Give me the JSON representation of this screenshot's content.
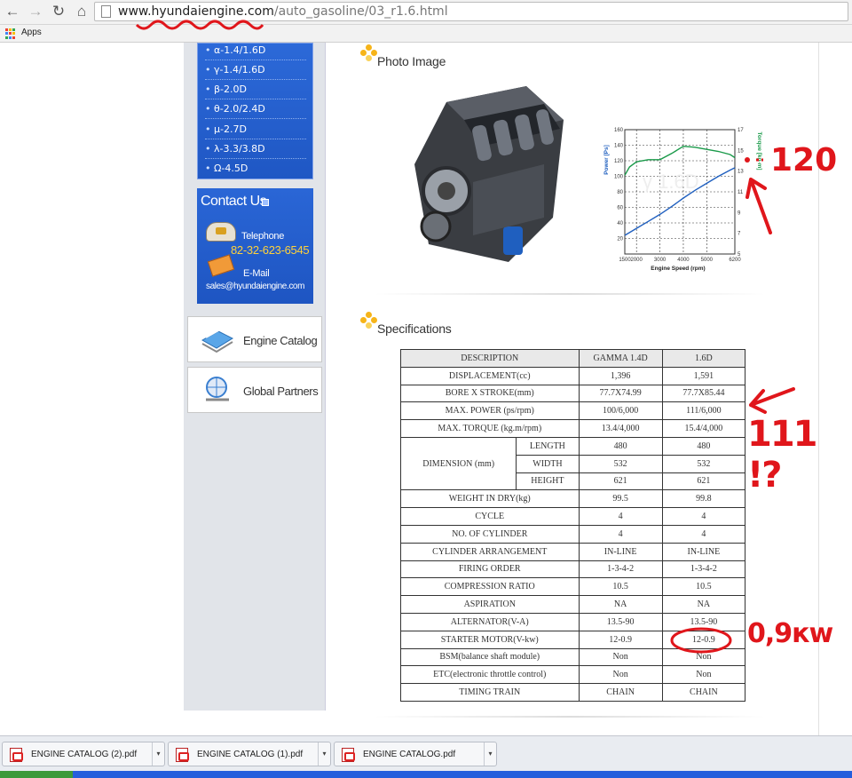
{
  "browser": {
    "url_host": "www.hyundaiengine.com",
    "url_path": "/auto_gasoline/03_r1.6.html",
    "bookmarks_apps_label": "Apps"
  },
  "sidebar": {
    "menu_items": [
      "α-1.4/1.6D",
      "γ-1.4/1.6D",
      "β-2.0D",
      "θ-2.0/2.4D",
      "μ-2.7D",
      "λ-3.3/3.8D",
      "Ω-4.5D"
    ],
    "contact": {
      "title": "Contact Us",
      "telephone_label": "Telephone",
      "telephone": "82-32-623-6545",
      "email_label": "E-Mail",
      "email": "sales@hyundaiengine.com"
    },
    "engine_catalog_label": "Engine Catalog",
    "global_partners_label": "Global Partners"
  },
  "photo_section": {
    "title": "Photo Image"
  },
  "chart_data": {
    "type": "line",
    "xlabel": "Engine Speed (rpm)",
    "ylabel_left": "Power [Ps]",
    "ylabel_right": "Torque [kg-m]",
    "x_ticks": [
      1500,
      2000,
      3000,
      4000,
      5000,
      6200
    ],
    "y_left_ticks": [
      20,
      40,
      60,
      80,
      100,
      120,
      140,
      160
    ],
    "y_right_ticks": [
      5,
      7,
      9,
      11,
      13,
      15,
      17
    ],
    "xlim": [
      1500,
      6200
    ],
    "ylim_left": [
      0,
      160
    ],
    "ylim_right": [
      5,
      17
    ],
    "watermark": "γ 1.6D",
    "series": [
      {
        "name": "Power",
        "color": "#1f5fbf",
        "x": [
          1500,
          2000,
          2500,
          3000,
          3500,
          4000,
          4500,
          5000,
          5500,
          6000,
          6200
        ],
        "values": [
          24,
          33,
          42,
          51,
          61,
          72,
          82,
          91,
          100,
          108,
          111
        ]
      },
      {
        "name": "Torque",
        "color": "#1a9a4a",
        "x": [
          1500,
          1700,
          2000,
          2500,
          3000,
          3500,
          4000,
          4500,
          5000,
          5500,
          6000,
          6200
        ],
        "values": [
          12.6,
          13.4,
          13.9,
          14.1,
          14.1,
          14.7,
          15.4,
          15.3,
          15.1,
          14.9,
          14.6,
          14.3
        ]
      }
    ]
  },
  "specs": {
    "title": "Specifications",
    "header": [
      "DESCRIPTION",
      "GAMMA 1.4D",
      "1.6D"
    ],
    "rows_before": [
      [
        "DISPLACEMENT(cc)",
        "1,396",
        "1,591"
      ],
      [
        "BORE X STROKE(mm)",
        "77.7X74.99",
        "77.7X85.44"
      ],
      [
        "MAX. POWER (ps/rpm)",
        "100/6,000",
        "111/6,000"
      ],
      [
        "MAX. TORQUE (kg.m/rpm)",
        "13.4/4,000",
        "15.4/4,000"
      ]
    ],
    "dimension": {
      "label": "DIMENSION (mm)",
      "rows": [
        [
          "LENGTH",
          "480",
          "480"
        ],
        [
          "WIDTH",
          "532",
          "532"
        ],
        [
          "HEIGHT",
          "621",
          "621"
        ]
      ]
    },
    "rows_after": [
      [
        "WEIGHT IN DRY(kg)",
        "99.5",
        "99.8"
      ],
      [
        "CYCLE",
        "4",
        "4"
      ],
      [
        "NO. OF CYLINDER",
        "4",
        "4"
      ],
      [
        "CYLINDER ARRANGEMENT",
        "IN-LINE",
        "IN-LINE"
      ],
      [
        "FIRING ORDER",
        "1-3-4-2",
        "1-3-4-2"
      ],
      [
        "COMPRESSION RATIO",
        "10.5",
        "10.5"
      ],
      [
        "ASPIRATION",
        "NA",
        "NA"
      ],
      [
        "ALTERNATOR(V-A)",
        "13.5-90",
        "13.5-90"
      ],
      [
        "STARTER MOTOR(V-kw)",
        "12-0.9",
        "12-0.9"
      ],
      [
        "BSM(balance shaft module)",
        "Non",
        "Non"
      ],
      [
        "ETC(electronic throttle control)",
        "Non",
        "Non"
      ],
      [
        "TIMING TRAIN",
        "CHAIN",
        "CHAIN"
      ]
    ]
  },
  "annotations": {
    "torque_note": "120",
    "power_note": "111 !?",
    "starter_note": "0,9кw"
  },
  "downloads": [
    {
      "name": "ENGINE CATALOG (2).pdf"
    },
    {
      "name": "ENGINE CATALOG (1).pdf"
    },
    {
      "name": "ENGINE CATALOG.pdf"
    }
  ],
  "colors": {
    "accent_blue": "#1f57c4",
    "annotation_red": "#e0161b",
    "email_yellow": "#ffd23a"
  }
}
